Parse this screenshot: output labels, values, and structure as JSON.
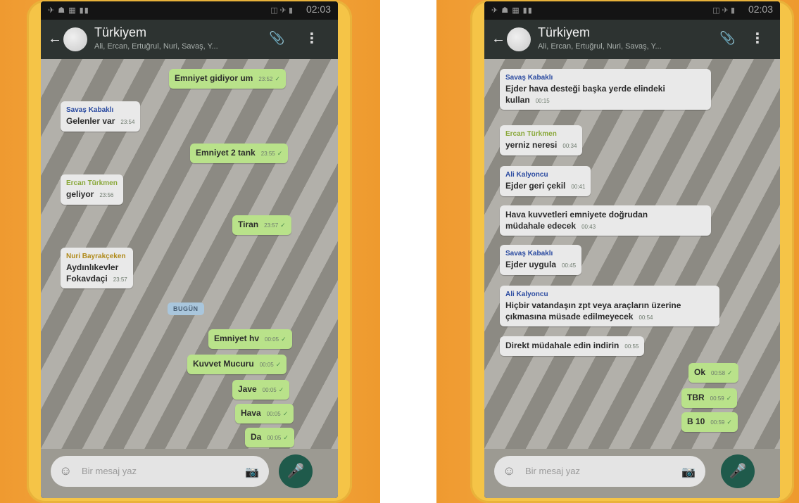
{
  "status_left": "✈ ☗ ▦ ▮▮",
  "status_icons": "◫ ✈ ▮",
  "clock": "02:03",
  "chat_title": "Türkiyem",
  "members": "Ali, Ercan, Ertuğrul, Nuri, Savaş, Y...",
  "placeholder": "Bir mesaj yaz",
  "icons": {
    "back": "back-arrow-icon",
    "attach": "paperclip-icon",
    "menu": "overflow-menu-icon",
    "emoji": "emoji-icon",
    "camera": "camera-icon",
    "mic": "microphone-icon"
  },
  "colors": {
    "outgoing_bubble": "#b9e28a",
    "incoming_bubble": "#e9e9e9",
    "app_bar": "#2d3331",
    "mic_button": "#1f5a4b",
    "sender_savas": "#2a4aa0",
    "sender_ercan": "#8aa83a",
    "sender_nuri": "#b08a1a",
    "sender_ali": "#2a4aa0"
  },
  "left_phone": {
    "messages": [
      {
        "dir": "out",
        "text": "Emniyet gidiyor um",
        "time": "23:52"
      },
      {
        "dir": "in",
        "sender": "Savaş Kabaklı",
        "text": "Gelenler var",
        "time": "23:54"
      },
      {
        "dir": "out",
        "text": "Emniyet 2 tank",
        "time": "23:55"
      },
      {
        "dir": "in",
        "sender": "Ercan Türkmen",
        "text": "geliyor",
        "time": "23:56"
      },
      {
        "dir": "out",
        "text": "Tiran",
        "time": "23:57"
      },
      {
        "dir": "in",
        "sender": "Nuri Bayrakçeken",
        "text": "Aydınlıkevler",
        "text2": "Fokavdaçi",
        "time": "23:57"
      },
      {
        "dir": "out",
        "text": "Emniyet hv",
        "time": "00:05"
      },
      {
        "dir": "out",
        "text": "Kuvvet Mucuru",
        "time": "00:05"
      },
      {
        "dir": "out",
        "text": "Jave",
        "time": "00:05"
      },
      {
        "dir": "out",
        "text": "Hava",
        "time": "00:05"
      },
      {
        "dir": "out",
        "text": "Da",
        "time": "00:05"
      }
    ],
    "date_chip": "BUGÜN"
  },
  "right_phone": {
    "messages": [
      {
        "dir": "in",
        "sender": "Savaş Kabaklı",
        "text": "Ejder hava desteği başka yerde elindeki",
        "text2": "kullan",
        "time": "00:15"
      },
      {
        "dir": "in",
        "sender": "Ercan Türkmen",
        "text": "yerniz neresi",
        "time": "00:34"
      },
      {
        "dir": "in",
        "sender": "Ali Kalyoncu",
        "text": "Ejder geri çekil",
        "time": "00:41"
      },
      {
        "dir": "in",
        "text": "Hava kuvvetleri emniyete doğrudan",
        "text2": "müdahale edecek",
        "time": "00:43"
      },
      {
        "dir": "in",
        "sender": "Savaş Kabaklı",
        "text": "Ejder uygula",
        "time": "00:45"
      },
      {
        "dir": "in",
        "sender": "Ali Kalyoncu",
        "text": "Hiçbir vatandaşın zpt veya araçların üzerine",
        "text2": "çıkmasına müsade edilmeyecek",
        "time": "00:54"
      },
      {
        "dir": "in",
        "text": "Direkt müdahale edin indirin",
        "time": "00:55"
      },
      {
        "dir": "out",
        "text": "Ok",
        "time": "00:58"
      },
      {
        "dir": "out",
        "text": "TBR",
        "time": "00:59"
      },
      {
        "dir": "out",
        "text": "B 10",
        "time": "00:59"
      }
    ]
  }
}
